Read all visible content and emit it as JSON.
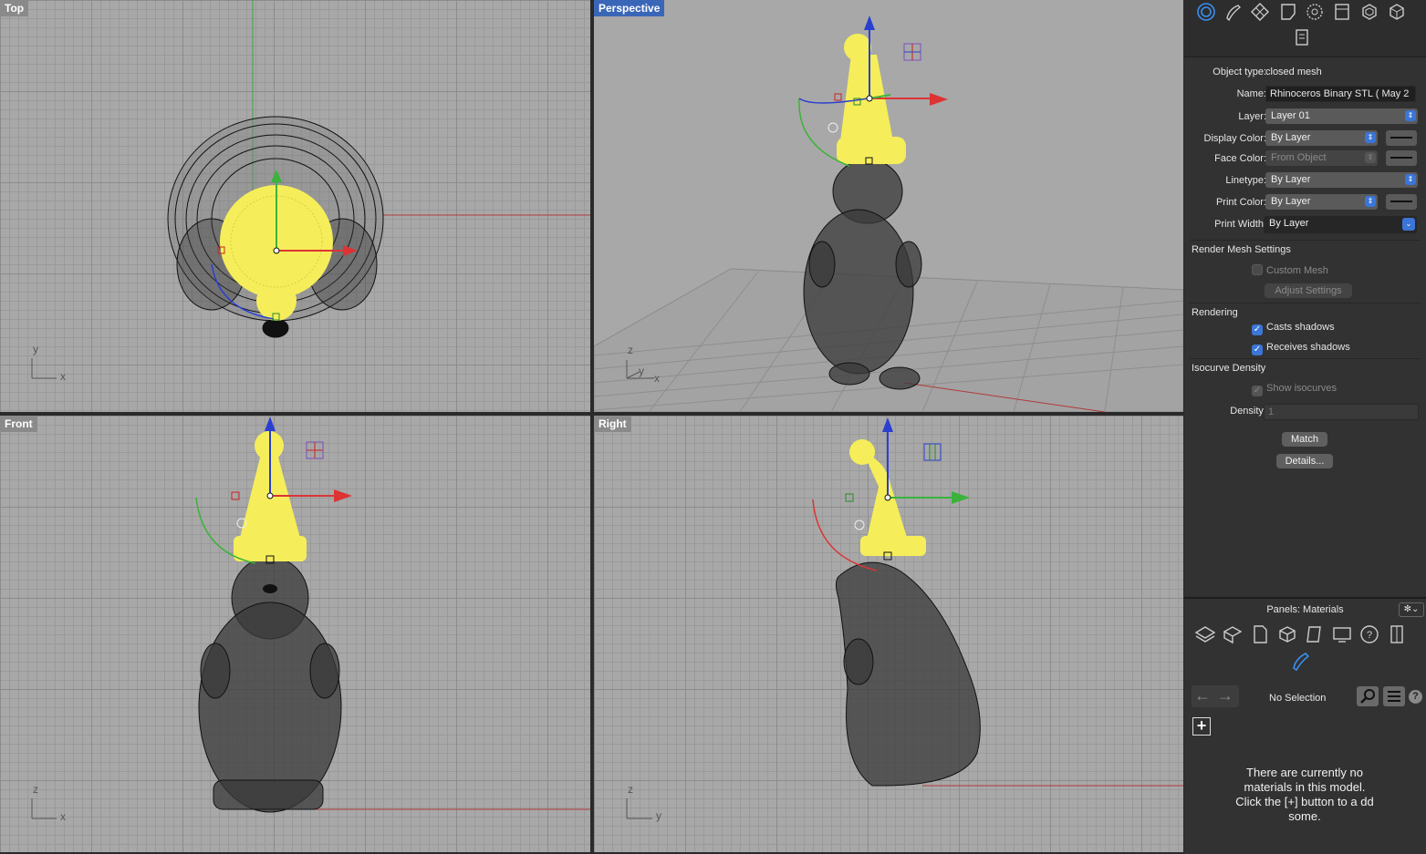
{
  "viewports": {
    "top": {
      "label": "Top",
      "axis_a": "y",
      "axis_b": "x"
    },
    "perspective": {
      "label": "Perspective",
      "axis_a": "z",
      "axis_b": "y",
      "axis_c": "x"
    },
    "front": {
      "label": "Front",
      "axis_a": "z",
      "axis_b": "x"
    },
    "right": {
      "label": "Right",
      "axis_a": "z",
      "axis_b": "y"
    }
  },
  "properties": {
    "object_type_label": "Object type:",
    "object_type_value": "closed mesh",
    "name_label": "Name:",
    "name_value": "Rhinoceros Binary STL ( May 2",
    "layer_label": "Layer:",
    "layer_value": "Layer 01",
    "display_color_label": "Display Color:",
    "display_color_value": "By Layer",
    "face_color_label": "Face Color:",
    "face_color_value": "From Object",
    "linetype_label": "Linetype:",
    "linetype_value": "By Layer",
    "print_color_label": "Print Color:",
    "print_color_value": "By Layer",
    "print_width_label": "Print Width:",
    "print_width_value": "By Layer",
    "render_mesh_title": "Render Mesh Settings",
    "custom_mesh_label": "Custom Mesh",
    "adjust_settings_label": "Adjust Settings",
    "rendering_title": "Rendering",
    "casts_shadows_label": "Casts shadows",
    "receives_shadows_label": "Receives shadows",
    "isocurve_title": "Isocurve Density",
    "show_isocurves_label": "Show isocurves",
    "density_label": "Density:",
    "density_value": "1",
    "match_label": "Match",
    "details_label": "Details..."
  },
  "materials": {
    "panel_title": "Panels: Materials",
    "no_selection": "No Selection",
    "empty_message": "There are currently no materials in this model. Click the [+] button to a dd some.",
    "add_label": "+"
  },
  "colors": {
    "viewport_bg": "#a8a8a8",
    "active_label": "#3a66b8",
    "hat_yellow": "#f5ee5a",
    "accent_blue": "#3b75d8"
  }
}
